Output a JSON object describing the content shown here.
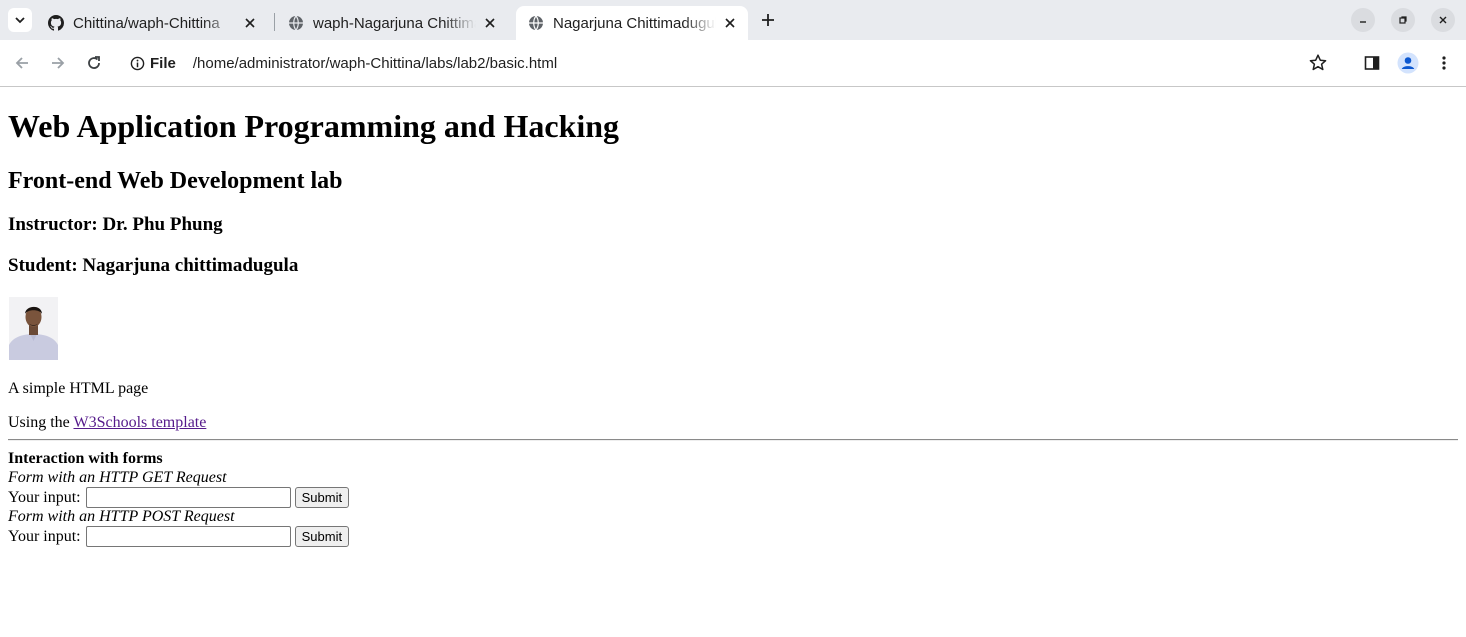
{
  "browser": {
    "tabs": [
      {
        "title": "Chittina/waph-Chittina",
        "icon": "github-icon",
        "active": false
      },
      {
        "title": "waph-Nagarjuna Chittimadugula",
        "icon": "globe-icon",
        "active": false
      },
      {
        "title": "Nagarjuna Chittimadugula",
        "icon": "globe-icon",
        "active": true
      }
    ],
    "address_chip": "File",
    "url": "/home/administrator/waph-Chittina/labs/lab2/basic.html"
  },
  "page": {
    "title": "Web Application Programming and Hacking",
    "subtitle": "Front-end Web Development lab",
    "instructor": "Instructor: Dr. Phu Phung",
    "student": "Student: Nagarjuna chittimadugula",
    "description": "A simple HTML page",
    "template_prefix": "Using the ",
    "template_link": "W3Schools template",
    "forms_heading": "Interaction with forms",
    "get_form": {
      "caption": "Form with an HTTP GET Request",
      "input_label": "Your input:",
      "input_value": "",
      "submit_label": "Submit"
    },
    "post_form": {
      "caption": "Form with an HTTP POST Request",
      "input_label": "Your input:",
      "input_value": "",
      "submit_label": "Submit"
    }
  },
  "colors": {
    "tabstrip": "#e9ebef",
    "link_visited": "#551a8b"
  }
}
